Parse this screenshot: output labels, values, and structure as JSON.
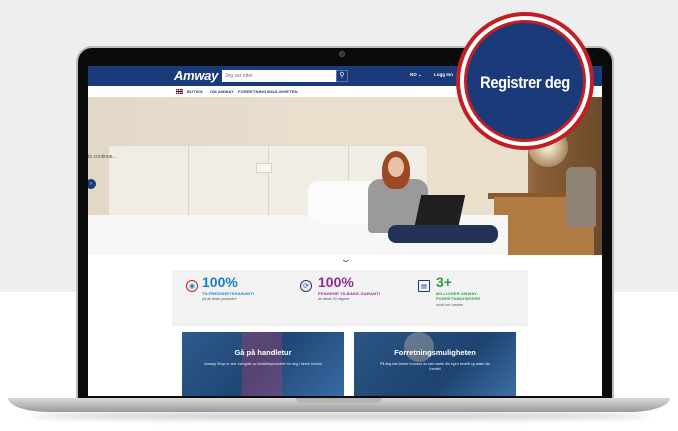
{
  "header": {
    "logo": "Amway",
    "search_placeholder": "Jeg ser etter",
    "language": "NO ⌄",
    "login": "Logg Inn"
  },
  "subnav": {
    "items": [
      "BUTIKK",
      "OM AMWAY",
      "FORRETNINGSMULIGHETEN"
    ]
  },
  "hero": {
    "continue_text": "to continue..."
  },
  "guarantees": [
    {
      "number": "100%",
      "label": "TILFREDSHETSGARANTI",
      "sub": "på de fleste produkter*",
      "color": "#1a7fc1"
    },
    {
      "number": "100%",
      "label": "PENGENE TILBAKE-GARANTI",
      "sub": "de første 90 dagene",
      "color": "#8e2d8e"
    },
    {
      "number": "3+",
      "label": "MILLIONER AMWAY-FORRETNINGSEIERE",
      "sub": "rundt om i verden",
      "color": "#2f9b47"
    }
  ],
  "cards": [
    {
      "title": "Gå på handletur",
      "text": "Amway Shop er stor mengder av kvalitetsprodukter for deg i deres forhold"
    },
    {
      "title": "Forretningsmuligheten",
      "text": "På deg kan bedre hvordan du kan starte din egen bedrift og stake din fremtid"
    }
  ],
  "zoom_callout": {
    "label": "Registrer deg"
  },
  "colors": {
    "brand": "#1a3a79",
    "callout_ring": "#c02025"
  }
}
